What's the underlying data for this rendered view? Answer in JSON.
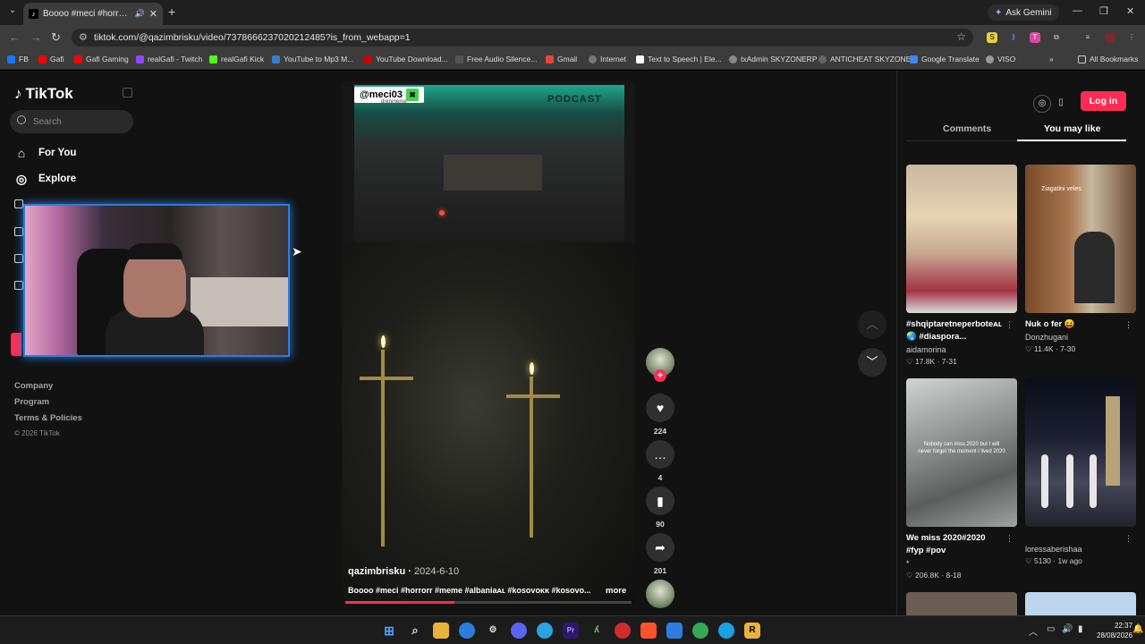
{
  "browser": {
    "tab_title": "Boooo #meci #horrorr #meme #albania #kosovo",
    "ask_gemini": "Ask Gemini",
    "url": "tiktok.com/@qazimbrisku/video/7378666237020212485?is_from_webapp=1",
    "bookmarks": [
      "FB",
      "Gafi",
      "Gafi Gaming",
      "realGafi - Twitch",
      "realGafi Kick",
      "YouTube to Mp3 M...",
      "YouTube Download...",
      "Free Audio Silence...",
      "Gmail",
      "Internet",
      "Text to Speech | Ele...",
      "txAdmin SKYZONERP",
      "ANTICHEAT SKYZONE",
      "Google Translate",
      "VISO"
    ],
    "all_bookmarks": "All Bookmarks"
  },
  "sidebar": {
    "logo": "TikTok",
    "search_placeholder": "Search",
    "nav": [
      "For You",
      "Explore"
    ],
    "footer": [
      "Company",
      "Program",
      "Terms & Policies"
    ],
    "copyright": "© 2026 TikTok"
  },
  "video": {
    "watermark": "@meci03",
    "watermark_sub": "drenmeme",
    "scene_text": "PODCAST",
    "author": "qazimbrisku",
    "date": "2024-6-10",
    "description": "Boooo #meci #horrorr #meme #albaniaᴀʟ #kosovoᴋᴋ #kosovo...",
    "more": "more",
    "progress": 0.38
  },
  "actions": {
    "likes": "224",
    "comments": "4",
    "saves": "90",
    "shares": "201"
  },
  "right_panel": {
    "login": "Log in",
    "tabs": [
      "Comments",
      "You may like"
    ],
    "cards": [
      {
        "title": "#shqiptaretneperboteᴀʟ",
        "title2": "🌏 #diaspora...",
        "user": "aidamorina",
        "likes": "17.8K",
        "date": "7-31"
      },
      {
        "title": "Nuk o fer 😝",
        "title2": "",
        "user": "Donzhugani",
        "likes": "11.4K",
        "date": "7-30",
        "overlay": "Ziagatini veles"
      },
      {
        "title": "We miss 2020#2020",
        "title2": "#fyp #pov",
        "user": "*",
        "likes": "206.8K",
        "date": "8-18",
        "overlay": "Nobody can miss 2020 but I will never forget the moment i lived 2020"
      },
      {
        "title": "",
        "title2": "",
        "user": "loressaberishaa",
        "likes": "5130",
        "date": "1w ago"
      }
    ]
  },
  "taskbar": {
    "time": "22:37",
    "date": "28/08/2026"
  },
  "colors": {
    "accent": "#fe2c55",
    "webcam_border": "#2b7de0"
  }
}
